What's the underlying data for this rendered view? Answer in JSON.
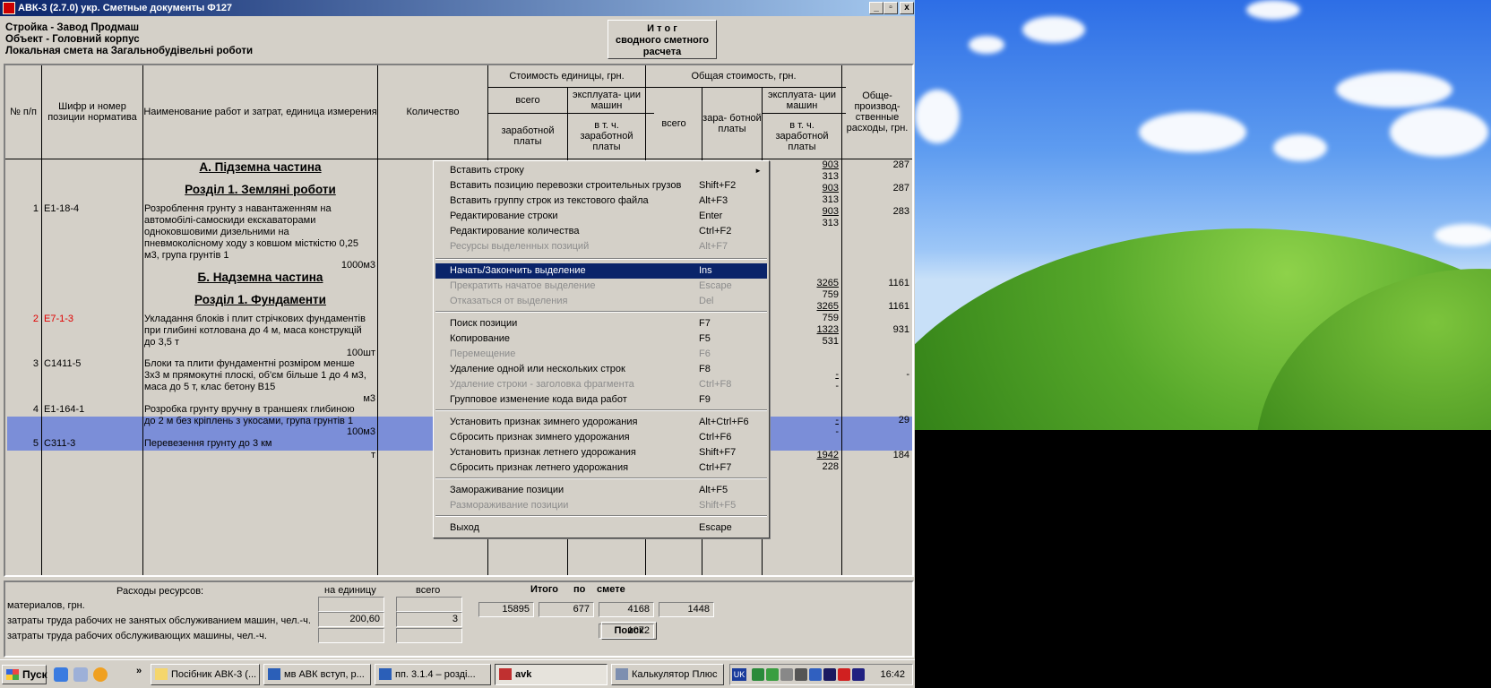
{
  "window": {
    "title": "АВК-3 (2.7.0)  укр.  Сметные документы        Ф127",
    "min_label": "_",
    "max_label": "▫",
    "close_label": "x"
  },
  "header": {
    "line1": "Стройка - Завод Продмаш",
    "line2": "Объект - Головний корпус",
    "line3": "Локальная смета на Загальнобудівельні роботи"
  },
  "itog_button": {
    "line1": "И т о г",
    "line2": "сводного сметного",
    "line3": "расчета"
  },
  "columns": {
    "num": "№ п/п",
    "code": "Шифр и номер позиции норматива",
    "name": "Наименование работ и затрат, единица измерения",
    "qty": "Количество",
    "unit_cost": "Стоимость единицы, грн.",
    "total_cost": "Общая стоимость, грн.",
    "vsego": "всего",
    "expl": "эксплуата- ции машин",
    "zarplaty": "заработной платы",
    "vtch": "в т. ч. заработной платы",
    "vsego2": "всего",
    "zarab": "зара- ботной платы",
    "expl2": "эксплуата- ции машин",
    "vtch2": "в т. ч. заработной платы",
    "overhead": "Обще- производ- ственные расходы, грн."
  },
  "sections": {
    "a": "А.   Підземна частина",
    "a1": "Розділ 1. Земляні роботи",
    "b": "Б.   Надземна частина",
    "b1": "Розділ 1. Фундаменти"
  },
  "rows": [
    {
      "n": "1",
      "code": "Е1-18-4",
      "name": "Розроблення грунту з навантаженням на автомобілі-самоскиди екскаваторами одноковшовими дизельними на пневмоколісному ходу з ковшом місткістю 0,25 м3, група грунтів 1",
      "unit": "1000м3"
    },
    {
      "n": "2",
      "code": "Е7-1-3",
      "name": "Укладання блоків і плит стрічкових фундаментів при глибині котлована до 4 м, маса конструкцій до 3,5 т",
      "unit": "100шт"
    },
    {
      "n": "3",
      "code": "С1411-5",
      "name": "Блоки та плити фундаментні розміром менше 3х3 м прямокутні плоскі, об'єм більше 1 до 4 м3, маса до 5 т, клас бетону В15",
      "unit": "м3"
    },
    {
      "n": "4",
      "code": "Е1-164-1",
      "name": "Розробка грунту вручну в траншеях глибиною до 2 м без кріплень з укосами, група грунтів 1",
      "unit": "100м3"
    },
    {
      "n": "5",
      "code": "С311-3",
      "name": "Перевезення грунту до 3 км",
      "unit": "т"
    }
  ],
  "right_values": [
    {
      "a": "903",
      "b": "313",
      "oh": "287"
    },
    {
      "a": "903",
      "b": "313",
      "oh": "287"
    },
    {
      "a": "903",
      "b": "313",
      "oh": "283"
    },
    {
      "a": "3265",
      "b": "759",
      "oh": "1161"
    },
    {
      "a": "3265",
      "b": "759",
      "oh": "1161"
    },
    {
      "a": "1323",
      "b": "531",
      "oh": "931"
    },
    {
      "a": "-",
      "b": "-",
      "oh": "-"
    },
    {
      "a": "-",
      "b": "-",
      "oh": "29"
    },
    {
      "a": "1942",
      "b": "228",
      "oh": "184"
    }
  ],
  "context_menu": {
    "items": [
      {
        "label": "Вставить строку",
        "shortcut": "",
        "submenu_glyph": "►"
      },
      {
        "label": "Вставить позицию перевозки строительных грузов",
        "shortcut": "Shift+F2"
      },
      {
        "label": "Вставить группу строк из текстового файла",
        "shortcut": "Alt+F3"
      },
      {
        "label": "Редактирование строки",
        "shortcut": "Enter"
      },
      {
        "label": "Редактирование количества",
        "shortcut": "Ctrl+F2"
      },
      {
        "label": "Ресурсы выделенных позиций",
        "shortcut": "Alt+F7"
      },
      {
        "label": "Начать/Закончить выделение",
        "shortcut": "Ins"
      },
      {
        "label": "Прекратить начатое выделение",
        "shortcut": "Escape"
      },
      {
        "label": "Отказаться от выделения",
        "shortcut": "Del"
      },
      {
        "label": "Поиск позиции",
        "shortcut": "F7"
      },
      {
        "label": "Копирование",
        "shortcut": "F5"
      },
      {
        "label": "Перемещение",
        "shortcut": "F6"
      },
      {
        "label": "Удаление одной или нескольких строк",
        "shortcut": "F8"
      },
      {
        "label": "Удаление строки - заголовка фрагмента",
        "shortcut": "Ctrl+F8"
      },
      {
        "label": "Групповое изменение кода вида работ",
        "shortcut": "F9"
      },
      {
        "label": "Установить признак зимнего удорожания",
        "shortcut": "Alt+Ctrl+F6"
      },
      {
        "label": "Сбросить признак зимнего удорожания",
        "shortcut": "Ctrl+F6"
      },
      {
        "label": "Установить признак летнего удорожания",
        "shortcut": "Shift+F7"
      },
      {
        "label": "Сбросить признак летнего удорожания",
        "shortcut": "Ctrl+F7"
      },
      {
        "label": "Замораживание позиции",
        "shortcut": "Alt+F5"
      },
      {
        "label": "Размораживание позиции",
        "shortcut": "Shift+F5"
      },
      {
        "label": "Выход",
        "shortcut": "Escape"
      }
    ]
  },
  "resources": {
    "title": "Расходы ресурсов:",
    "per_unit": "на единицу",
    "total": "всего",
    "mat": "материалов, грн.",
    "labor1": "затраты труда рабочих не занятых обслуживанием машин, чел.-ч.",
    "labor2": "затраты труда рабочих обслуживающих машины, чел.-ч.",
    "labor1_unit": "200,60",
    "labor1_total": "3",
    "itog1": "Итого",
    "itog2": "по",
    "itog3": "смете",
    "t1": "15895",
    "t2": "677",
    "t3": "4168",
    "t4": "1448",
    "t5": "1072",
    "search": "Поиск"
  },
  "taskbar": {
    "start": "Пуск",
    "chevron": "»",
    "tasks": [
      "Посібник АВК-3 (...",
      "мв АВК вступ, р...",
      "пп. 3.1.4 – розді...",
      "avk",
      "Калькулятор Плюс"
    ],
    "lang": "UK",
    "clock": "16:42"
  }
}
